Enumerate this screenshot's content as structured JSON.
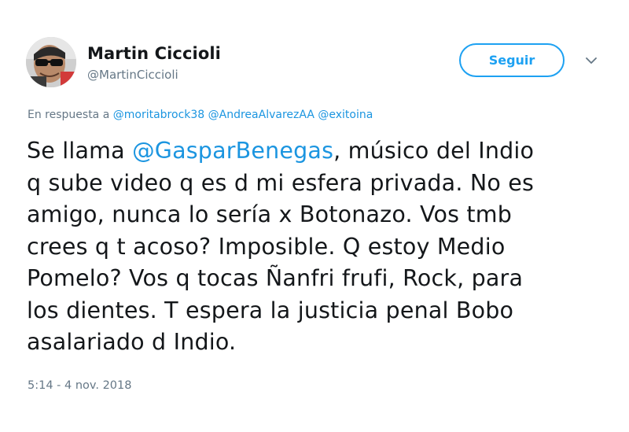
{
  "author": {
    "display_name": "Martin Ciccioli",
    "handle": "@MartinCiccioli"
  },
  "follow_button": {
    "label": "Seguir"
  },
  "reply_context": {
    "prefix": "En respuesta a",
    "mentions": [
      "@moritabrock38",
      "@AndreaAlvarezAA",
      "@exitoina"
    ]
  },
  "tweet": {
    "text_before_mention": "Se llama ",
    "mention": "@GasparBenegas",
    "text_after_mention": ", músico del Indio\nq sube video q es d mi esfera privada. No es\namigo, nunca lo sería x Botonazo. Vos tmb\ncrees q t acoso? Imposible. Q estoy Medio\nPomelo? Vos q tocas Ñanfri frufi, Rock, para\nlos dientes. T espera la justicia penal Bobo\nasalariado d Indio."
  },
  "timestamp": "5:14 - 4 nov. 2018",
  "colors": {
    "link": "#1b95e0",
    "follow_border": "#1da1f2",
    "secondary_text": "#657786",
    "primary_text": "#14171a"
  },
  "icons": {
    "caret": "chevron-down-icon"
  }
}
